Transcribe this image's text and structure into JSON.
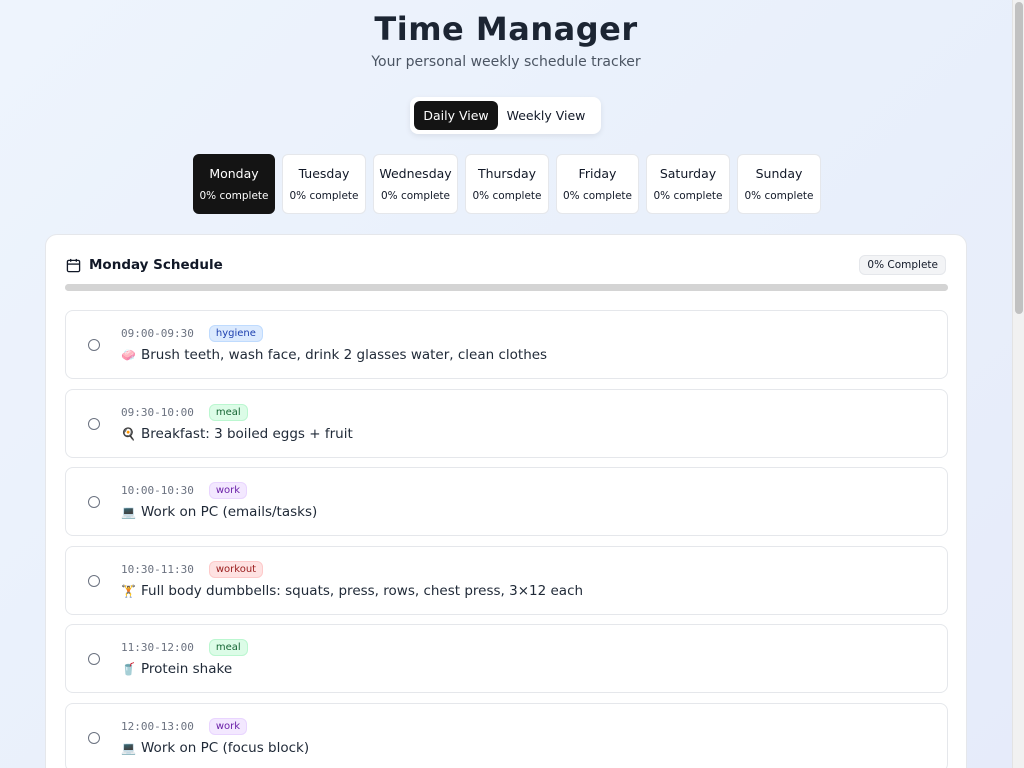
{
  "app": {
    "title": "Time Manager",
    "subtitle": "Your personal weekly schedule tracker"
  },
  "view_toggle": {
    "daily_label": "Daily View",
    "weekly_label": "Weekly View",
    "selected": "Daily View"
  },
  "days": [
    {
      "name": "Monday",
      "progress": "0% complete",
      "active": true
    },
    {
      "name": "Tuesday",
      "progress": "0% complete",
      "active": false
    },
    {
      "name": "Wednesday",
      "progress": "0% complete",
      "active": false
    },
    {
      "name": "Thursday",
      "progress": "0% complete",
      "active": false
    },
    {
      "name": "Friday",
      "progress": "0% complete",
      "active": false
    },
    {
      "name": "Saturday",
      "progress": "0% complete",
      "active": false
    },
    {
      "name": "Sunday",
      "progress": "0% complete",
      "active": false
    }
  ],
  "schedule": {
    "title": "Monday Schedule",
    "badge": "0% Complete",
    "progress_fraction": 0,
    "tasks": [
      {
        "time": "09:00-09:30",
        "tag": "hygiene",
        "emoji": "🧼",
        "text": "Brush teeth, wash face, drink 2 glasses water, clean clothes",
        "done": false
      },
      {
        "time": "09:30-10:00",
        "tag": "meal",
        "emoji": "🍳",
        "text": "Breakfast: 3 boiled eggs + fruit",
        "done": false
      },
      {
        "time": "10:00-10:30",
        "tag": "work",
        "emoji": "💻",
        "text": "Work on PC (emails/tasks)",
        "done": false
      },
      {
        "time": "10:30-11:30",
        "tag": "workout",
        "emoji": "🏋",
        "text": "Full body dumbbells: squats, press, rows, chest press, 3×12 each",
        "done": false
      },
      {
        "time": "11:30-12:00",
        "tag": "meal",
        "emoji": "🥤",
        "text": "Protein shake",
        "done": false
      },
      {
        "time": "12:00-13:00",
        "tag": "work",
        "emoji": "💻",
        "text": "Work on PC (focus block)",
        "done": false
      }
    ]
  },
  "icons": {
    "schedule_header": "calendar-icon",
    "task_toggle": "radio-circle-icon"
  },
  "colors": {
    "active": "#141414",
    "hygiene": "#dbeafe",
    "meal": "#dcfce7",
    "work": "#f3e8ff",
    "workout": "#fee2e2"
  }
}
